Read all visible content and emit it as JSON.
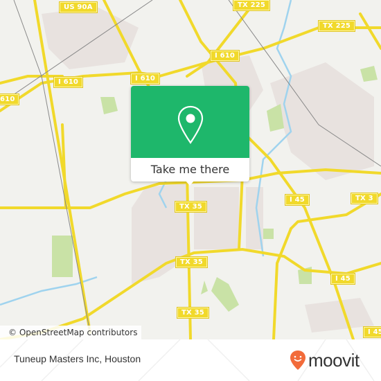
{
  "map": {
    "background_color": "#f2f2ee",
    "road_color": "#f1d92b",
    "water_color": "#9fd3ee",
    "park_color": "#c9e2a6",
    "shields": [
      {
        "label": "US 90A"
      },
      {
        "label": "TX 225"
      },
      {
        "label": "TX 225"
      },
      {
        "label": "I 610"
      },
      {
        "label": "I 610"
      },
      {
        "label": "I 610"
      },
      {
        "label": "610"
      },
      {
        "label": "TX 35"
      },
      {
        "label": "TX 35"
      },
      {
        "label": "TX 35"
      },
      {
        "label": "I 45"
      },
      {
        "label": "TX 3"
      },
      {
        "label": "I 45"
      },
      {
        "label": "I 45"
      }
    ],
    "attribution": "© OpenStreetMap contributors"
  },
  "popup": {
    "accent_color": "#1eb76b",
    "icon": "map-pin-icon",
    "cta_label": "Take me there"
  },
  "footer": {
    "place_name": "Tuneup Masters Inc, Houston",
    "brand": "moovit",
    "brand_color": "#f26b3a"
  }
}
